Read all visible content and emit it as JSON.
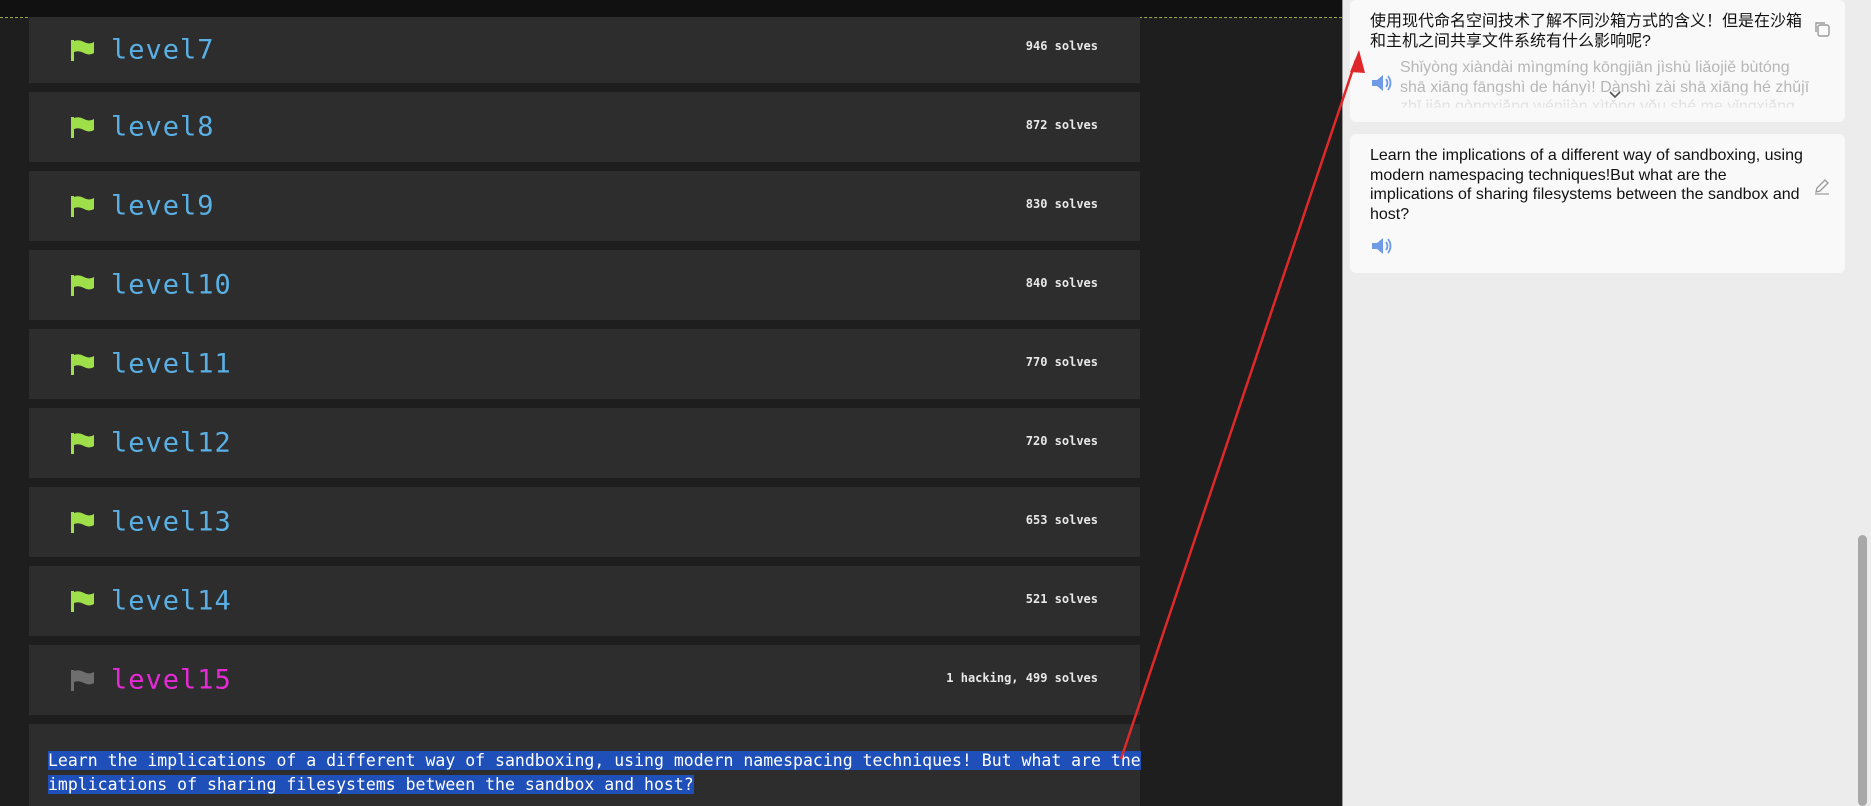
{
  "levels": [
    {
      "name": "level7",
      "solves": "946 solves",
      "status": "solved"
    },
    {
      "name": "level8",
      "solves": "872 solves",
      "status": "solved"
    },
    {
      "name": "level9",
      "solves": "830 solves",
      "status": "solved"
    },
    {
      "name": "level10",
      "solves": "840 solves",
      "status": "solved"
    },
    {
      "name": "level11",
      "solves": "770 solves",
      "status": "solved"
    },
    {
      "name": "level12",
      "solves": "720 solves",
      "status": "solved"
    },
    {
      "name": "level13",
      "solves": "653 solves",
      "status": "solved"
    },
    {
      "name": "level14",
      "solves": "521 solves",
      "status": "solved"
    },
    {
      "name": "level15",
      "solves": "1 hacking, 499 solves",
      "status": "active"
    }
  ],
  "description": {
    "line1": "Learn the implications of a different way of sandboxing, using modern namespacing techniques! But what are the",
    "line2": "implications of sharing filesystems between the sandbox and host?"
  },
  "translation_panel": {
    "chinese_text": "使用现代命名空间技术了解不同沙箱方式的含义！但是在沙箱和主机之间共享文件系统有什么影响呢?",
    "pinyin_text": "Shǐyòng xiàndài mìngmíng kōngjiān jìshù liǎojiě bùtóng shā xiāng fāngshì de hányì! Dànshì zài shā xiāng hé zhǔjī zhī jiān gòngxiǎng wénjiàn xìtǒng yǒu shé me yǐngxiǎng ne?",
    "english_text": "Learn the implications of a different way of sandboxing, using modern namespacing techniques!But what are the implications of sharing filesystems between the sandbox and host?"
  },
  "icons": {
    "level_flag_solved": "flag-icon",
    "level_flag_active": "flag-icon",
    "speaker": "speaker-icon",
    "copy": "copy-icon",
    "edit": "edit-icon",
    "expand": "chevron-down-icon"
  },
  "colors": {
    "level_name": "#5ab0e4",
    "level_name_active": "#e62ad6",
    "flag_solved": "#9fe04a",
    "flag_active": "#6e6e6e",
    "selection": "#1f4fb8",
    "arrow": "#e0282a"
  }
}
